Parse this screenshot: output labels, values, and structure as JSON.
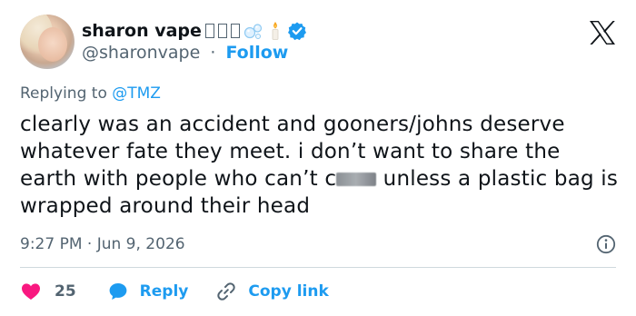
{
  "author": {
    "display_name": "sharon vape",
    "handle": "@sharonvape",
    "separator": "·",
    "follow_label": "Follow"
  },
  "reply": {
    "prefix": "Replying to ",
    "to_handle": "@TMZ"
  },
  "tweet": {
    "text_part1": "clearly was an accident and gooners/johns deserve whatever fate they meet. i don’t want to share the earth with people who can’t c",
    "text_part2": " unless a plastic bag is wrapped around their head",
    "time": "9:27 PM",
    "date": "Jun 9, 2026",
    "time_separator": " · "
  },
  "actions": {
    "like_count": "25",
    "reply_label": "Reply",
    "copy_link_label": "Copy link"
  },
  "colors": {
    "accent": "#1d9bf0",
    "like": "#f91880",
    "muted": "#536471",
    "text": "#0f1419"
  },
  "icons": [
    "bubbles-icon",
    "candle-icon",
    "verified-icon",
    "x-logo-icon",
    "info-icon",
    "heart-icon",
    "reply-bubble-icon",
    "link-icon"
  ]
}
